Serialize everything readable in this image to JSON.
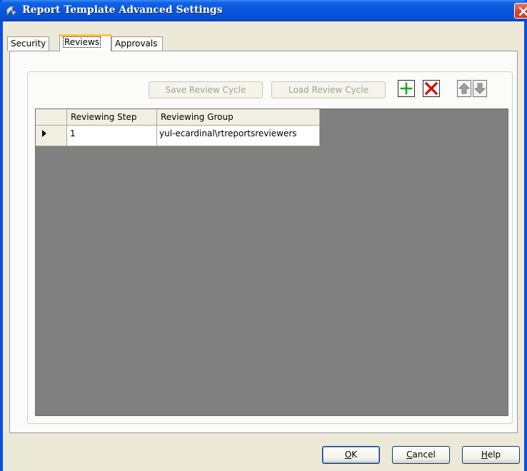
{
  "window": {
    "title": "Report Template Advanced Settings"
  },
  "tabs": [
    {
      "label": "Security",
      "active": false
    },
    {
      "label": "Reviews",
      "active": true
    },
    {
      "label": "Approvals",
      "active": false
    }
  ],
  "toolbar": {
    "save_review_cycle": "Save Review Cycle",
    "load_review_cycle": "Load Review Cycle"
  },
  "grid": {
    "columns": [
      "Reviewing Step",
      "Reviewing Group"
    ],
    "rows": [
      {
        "step": "1",
        "group": "yul-ecardinal\\rtreportsreviewers",
        "current": true
      }
    ]
  },
  "footer": {
    "ok": {
      "mnemonic": "O",
      "rest": "K"
    },
    "cancel": {
      "mnemonic": "C",
      "rest": "ancel"
    },
    "help": {
      "mnemonic": "H",
      "rest": "elp"
    }
  },
  "colors": {
    "title_bar": "#0a56dc",
    "add_icon": "#1fa31f",
    "delete_icon": "#e00000",
    "active_tab_accent": "#ffc83c",
    "grid_background": "#808080"
  }
}
